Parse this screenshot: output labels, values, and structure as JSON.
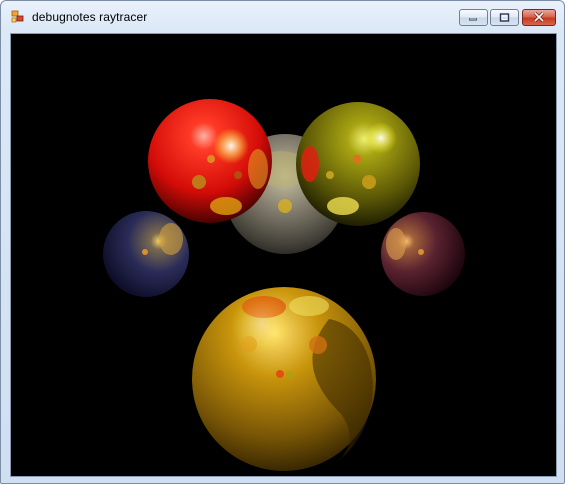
{
  "window": {
    "title": "debugnotes raytracer",
    "app_icon": "app-icon",
    "controls": {
      "minimize_icon": "minimize-icon",
      "maximize_icon": "maximize-icon",
      "close_icon": "close-icon"
    },
    "colors": {
      "titlebar": "#dbe8f6",
      "close_button": "#c43b22",
      "render_background": "#000000"
    }
  },
  "render": {
    "spheres": [
      {
        "id": "red",
        "color": "#ff1a10"
      },
      {
        "id": "olive",
        "color": "#8a8a0a"
      },
      {
        "id": "gray-back",
        "color": "#6f6f66"
      },
      {
        "id": "navy-left",
        "color": "#2b2f6a"
      },
      {
        "id": "maroon-right",
        "color": "#7a2a3a"
      },
      {
        "id": "gold-front",
        "color": "#c99a10"
      }
    ]
  }
}
